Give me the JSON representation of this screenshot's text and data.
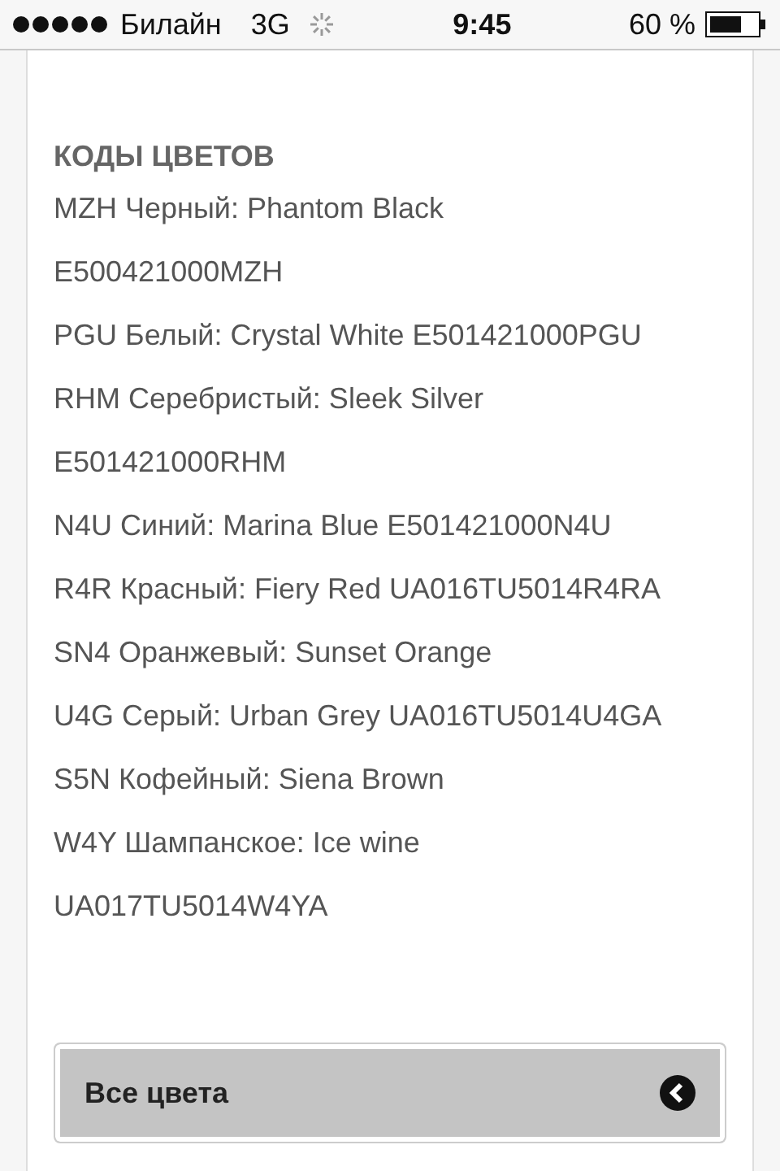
{
  "status_bar": {
    "carrier": "Билайн",
    "network": "3G",
    "time": "9:45",
    "battery": "60 %"
  },
  "section": {
    "title": "КОДЫ  ЦВЕТОВ",
    "lines": [
      "MZH Черный: Phantom Black",
      "E500421000MZH",
      "PGU Белый: Crystal White  E501421000PGU",
      "RHM Серебристый: Sleek Silver",
      "E501421000RHM",
      "N4U Синий: Marina Blue  E501421000N4U",
      "R4R Красный: Fiery Red  UA016TU5014R4RA",
      "SN4 Оранжевый: Sunset Orange",
      "U4G Серый: Urban Grey UA016TU5014U4GA",
      "S5N Кофейный: Siena Brown",
      "W4Y Шампанское: Ice wine",
      "UA017TU5014W4YA"
    ]
  },
  "all_colors_button": {
    "label": "Все цвета"
  }
}
